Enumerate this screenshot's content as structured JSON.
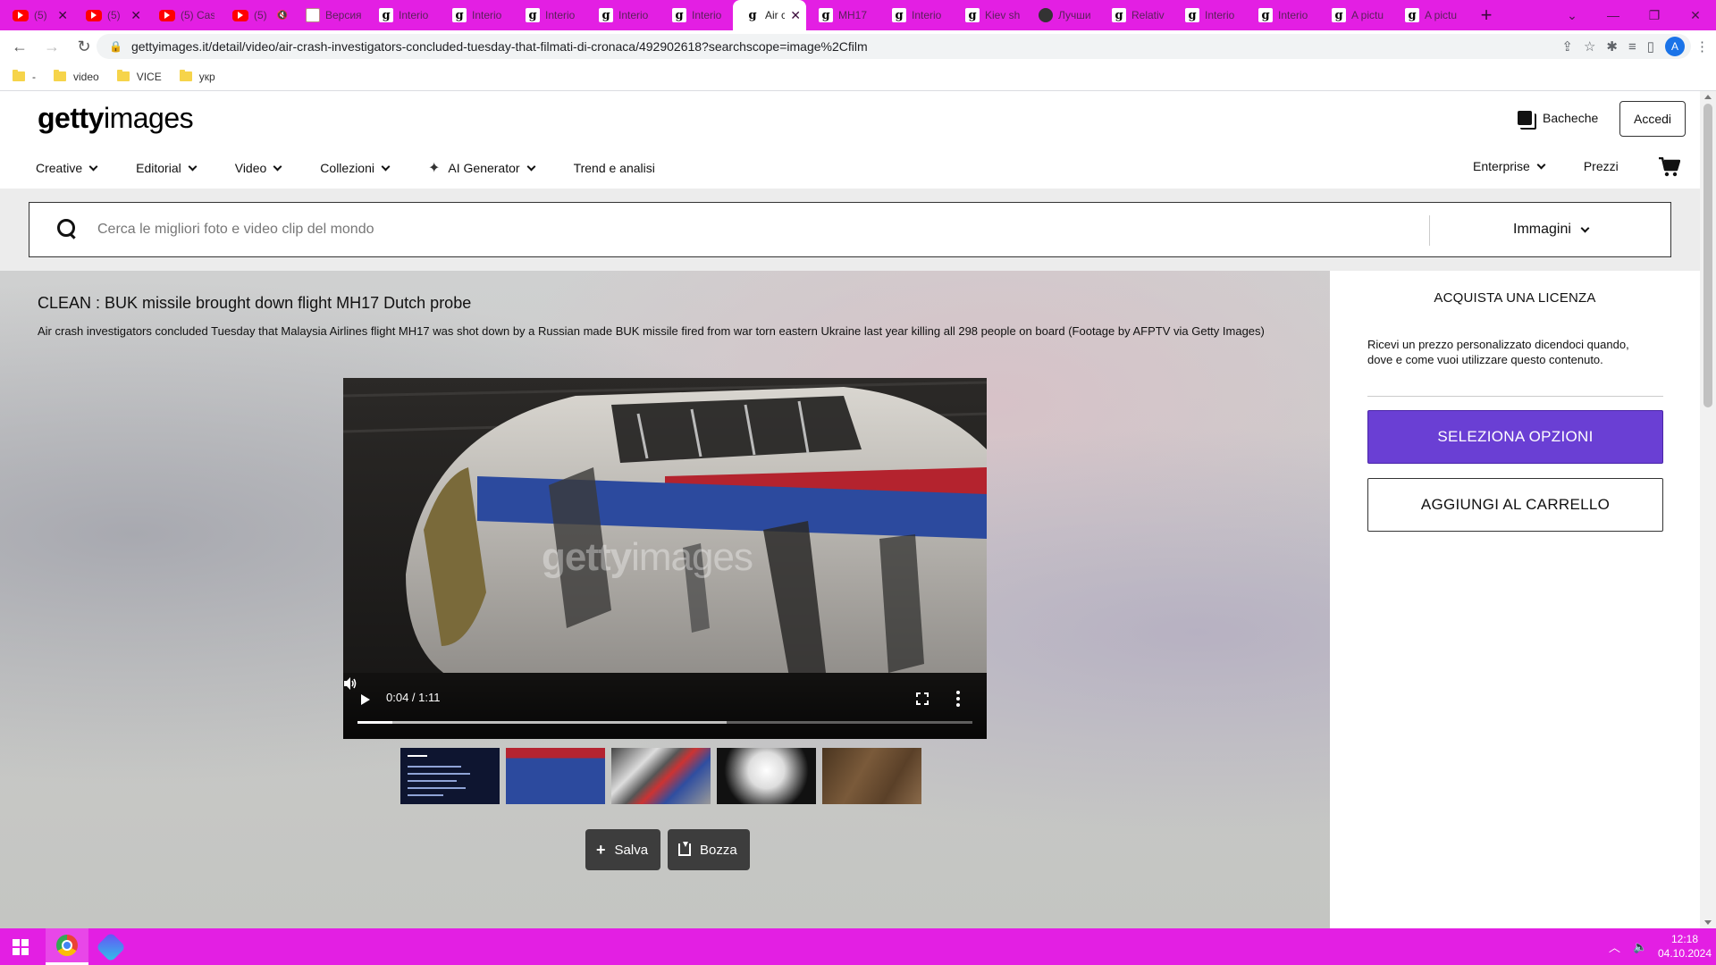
{
  "browser": {
    "tabs": [
      {
        "label": "(5)",
        "favicon": "youtube-icon",
        "closable": true
      },
      {
        "label": "(5)",
        "favicon": "youtube-icon",
        "closable": true
      },
      {
        "label": "(5) Cas",
        "favicon": "youtube-icon",
        "closable": false
      },
      {
        "label": "(5)",
        "favicon": "youtube-icon",
        "closable": false,
        "muted": true
      },
      {
        "label": "Версия",
        "favicon": "doc-icon",
        "closable": false
      },
      {
        "label": "Interio",
        "favicon": "getty-icon",
        "closable": false
      },
      {
        "label": "Interio",
        "favicon": "getty-icon",
        "closable": false
      },
      {
        "label": "Interio",
        "favicon": "getty-icon",
        "closable": false
      },
      {
        "label": "Interio",
        "favicon": "getty-icon",
        "closable": false
      },
      {
        "label": "Interio",
        "favicon": "getty-icon",
        "closable": false
      },
      {
        "label": "Air c",
        "favicon": "getty-icon",
        "closable": true,
        "active": true
      },
      {
        "label": "MH17",
        "favicon": "getty-icon",
        "closable": false
      },
      {
        "label": "Interio",
        "favicon": "getty-icon",
        "closable": false
      },
      {
        "label": "Kiev sh",
        "favicon": "getty-icon",
        "closable": false
      },
      {
        "label": "Лучши",
        "favicon": "web-icon",
        "closable": false
      },
      {
        "label": "Relativ",
        "favicon": "getty-icon",
        "closable": false
      },
      {
        "label": "Interio",
        "favicon": "getty-icon",
        "closable": false
      },
      {
        "label": "Interio",
        "favicon": "getty-icon",
        "closable": false
      },
      {
        "label": "A pictu",
        "favicon": "getty-icon",
        "closable": false
      },
      {
        "label": "A pictu",
        "favicon": "getty-icon",
        "closable": false
      }
    ],
    "url": "gettyimages.it/detail/video/air-crash-investigators-concluded-tuesday-that-filmati-di-cronaca/492902618?searchscope=image%2Cfilm",
    "profile_initial": "A",
    "bookmarks": [
      {
        "label": "-"
      },
      {
        "label": "video"
      },
      {
        "label": "VICE"
      },
      {
        "label": "укр"
      }
    ]
  },
  "header": {
    "logo_bold": "getty",
    "logo_light": "images",
    "boards_label": "Bacheche",
    "signin_label": "Accedi",
    "nav": [
      {
        "label": "Creative",
        "dropdown": true
      },
      {
        "label": "Editorial",
        "dropdown": true
      },
      {
        "label": "Video",
        "dropdown": true
      },
      {
        "label": "Collezioni",
        "dropdown": true
      },
      {
        "label": "AI Generator",
        "dropdown": true,
        "icon": "sparkle-icon"
      },
      {
        "label": "Trend e analisi",
        "dropdown": false
      }
    ],
    "enterprise_label": "Enterprise",
    "pricing_label": "Prezzi"
  },
  "search": {
    "placeholder": "Cerca le migliori foto e video clip del mondo",
    "scope_label": "Immagini"
  },
  "video": {
    "title": "CLEAN : BUK missile brought down flight MH17 Dutch probe",
    "description": "Air crash investigators concluded Tuesday that Malaysia Airlines flight MH17 was shot down by a Russian made BUK missile fired from war torn eastern Ukraine last year killing all 298 people on board (Footage by AFPTV via Getty Images)",
    "watermark_bold": "getty",
    "watermark_light": "images",
    "current_time": "0:04",
    "duration": "1:11",
    "timecode": "0:04 / 1:11",
    "played_fraction": 0.056,
    "buffered_fraction": 0.6,
    "thumbnail_count": 5
  },
  "actions": {
    "save_label": "Salva",
    "draft_label": "Bozza"
  },
  "license": {
    "title": "ACQUISTA UNA LICENZA",
    "description": "Ricevi un prezzo personalizzato dicendoci quando, dove e come vuoi utilizzare questo contenuto.",
    "primary_label": "SELEZIONA OPZIONI",
    "secondary_label": "AGGIUNGI AL CARRELLO",
    "primary_color": "#6a3fd4"
  },
  "taskbar": {
    "time": "12:18",
    "date": "04.10.2024",
    "accent_color": "#e31fe3"
  }
}
